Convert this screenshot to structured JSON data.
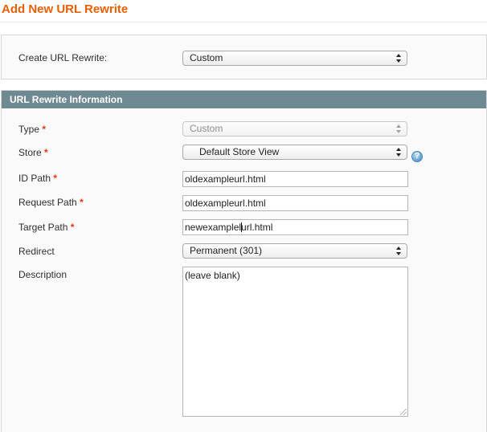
{
  "page": {
    "title": "Add New URL Rewrite"
  },
  "create_box": {
    "label": "Create URL Rewrite:",
    "select_value": "Custom"
  },
  "section": {
    "title": "URL Rewrite Information"
  },
  "form": {
    "required_mark": "*",
    "type": {
      "label": "Type",
      "value": "Custom"
    },
    "store": {
      "label": "Store",
      "value": "Default Store View",
      "help_glyph": "?"
    },
    "id_path": {
      "label": "ID Path",
      "value": "oldexampleurl.html"
    },
    "request_path": {
      "label": "Request Path",
      "value": "oldexampleurl.html"
    },
    "target_path": {
      "label": "Target Path",
      "value_before_cursor": "newexamplel",
      "value_after_cursor": "url.html"
    },
    "redirect": {
      "label": "Redirect",
      "value": "Permanent (301)"
    },
    "description": {
      "label": "Description",
      "value": "(leave blank)"
    }
  },
  "colors": {
    "title": "#eb5e00",
    "section_header": "#6f8992",
    "required": "#eb340a",
    "panel_bg": "#fafafa"
  },
  "icons": {
    "help": "help-icon"
  }
}
